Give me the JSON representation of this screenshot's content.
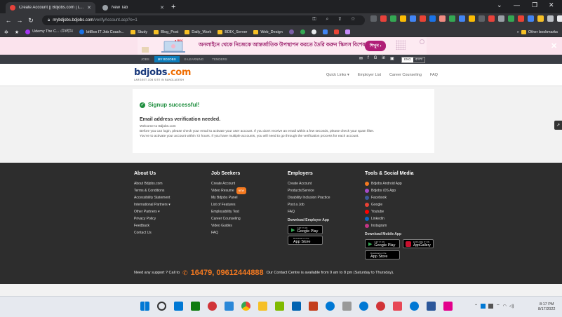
{
  "browser": {
    "tabs": [
      {
        "title": "Create Account || Bdjobs.com | L..."
      },
      {
        "title": "New Tab"
      }
    ],
    "address": {
      "host": "mybdjobs.bdjobs.com",
      "path": "/verifyAccount.asp?e=1"
    },
    "bookmarks": [
      "Udemy The C... টেকইটম",
      "bitBox IT Job Coach...",
      "Study",
      "Blog_Post",
      "Daily_Work",
      "BDIX_Server",
      "Web_Design"
    ],
    "bookmarks_more": "Other bookmarks"
  },
  "ad": {
    "text": "অনলাইনে থেকে নিজেকে আন্তর্জাতিক উপস্থাপন করতে তৈরি করুন স্কিলস বিশেষজ্ঞ",
    "button": "শিখুন ›",
    "rec_label": "● REC"
  },
  "site_top": {
    "tabs": [
      "JOBS",
      "MY BDJOBS",
      "E-LEARNING",
      "TENDERS"
    ],
    "social": [
      "✉",
      "f",
      "G",
      "in",
      "▣"
    ],
    "lang": [
      "ENG",
      "বাংলা"
    ]
  },
  "header": {
    "logo_main": "bdjobs",
    "logo_ext": ".com",
    "tagline": "LARGEST JOB SITE IN BANGLADESH",
    "nav": [
      "Quick Links ▾",
      "Employer List",
      "Career Counseling",
      "FAQ"
    ]
  },
  "card": {
    "success": "Signup successful!",
    "heading": "Email address verification needed.",
    "lines": [
      "Welcome to Bdjobs.com",
      "Before you can login, please check your email to activate your user account. If you don't receive an email within a few seconds, please check your spam filter.",
      "You've to activate your account within 72 hours. If you have multiple accounts, you will need to go through the verification process for each account."
    ]
  },
  "side_widget": "↗",
  "footer": {
    "about": {
      "title": "About Us",
      "links": [
        "About Bdjobs.com",
        "Terms & Conditions",
        "Accessibility Statement",
        "International Partners ▾",
        "Other Partners ▾",
        "Privacy Policy",
        "Feedback",
        "Contact Us"
      ]
    },
    "seekers": {
      "title": "Job Seekers",
      "links": [
        "Create Account",
        "Video Resume",
        "My Bdjobs Panel",
        "List of Features",
        "Employability Test",
        "Career Counseling",
        "Video Guides",
        "FAQ"
      ],
      "new_badge": "NEW"
    },
    "employers": {
      "title": "Employers",
      "links": [
        "Create Account",
        "Products/Service",
        "Disability Inclusion Practice",
        "Post a Job",
        "FAQ"
      ],
      "app_label": "Download Employer App"
    },
    "tools": {
      "title": "Tools & Social Media",
      "links": [
        "Bdjobs Android App",
        "Bdjobs iOS App",
        "Facebook",
        "Google",
        "Youtube",
        "LinkedIn",
        "Instagram"
      ],
      "mobile_label": "Download Mobile App"
    },
    "stores": {
      "google_small": "GET IT ON",
      "google": "Google Play",
      "apple_small": "Download on the",
      "apple": "App Store",
      "gallery_small": "EXPLORE IT ON",
      "gallery": "AppGallery"
    },
    "support": {
      "prefix": "Need any support ? Call to",
      "phone": "16479, 09612444888",
      "suffix": "Our Contact Centre is available from 9 am to 8 pm (Saturday to Thursday)."
    }
  },
  "taskbar": {
    "time": "8:17 PM",
    "date": "8/17/2022"
  }
}
